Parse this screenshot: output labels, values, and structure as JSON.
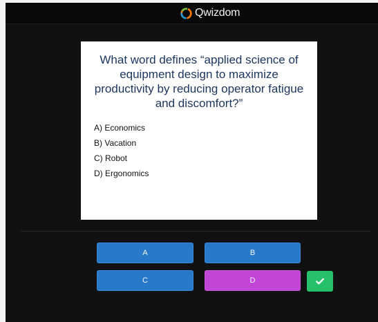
{
  "app": {
    "brand_name": "Qwizdom"
  },
  "question": {
    "text": "What word defines “applied science of equipment design to maximize productivity by reducing operator fatigue and discomfort?”",
    "options": [
      "A) Economics",
      "B) Vacation",
      "C) Robot",
      "D) Ergonomics"
    ]
  },
  "answers": {
    "buttons": [
      {
        "label": "A",
        "state": "default",
        "color": "#2979ca"
      },
      {
        "label": "B",
        "state": "default",
        "color": "#2979ca"
      },
      {
        "label": "C",
        "state": "default",
        "color": "#2979ca"
      },
      {
        "label": "D",
        "state": "selected",
        "color": "#c246d6"
      }
    ],
    "submit_icon": "checkmark-icon",
    "submit_color": "#27c06a"
  },
  "theme": {
    "background": "#111111",
    "card": "#ffffff",
    "question_text_color": "#1c355e"
  }
}
